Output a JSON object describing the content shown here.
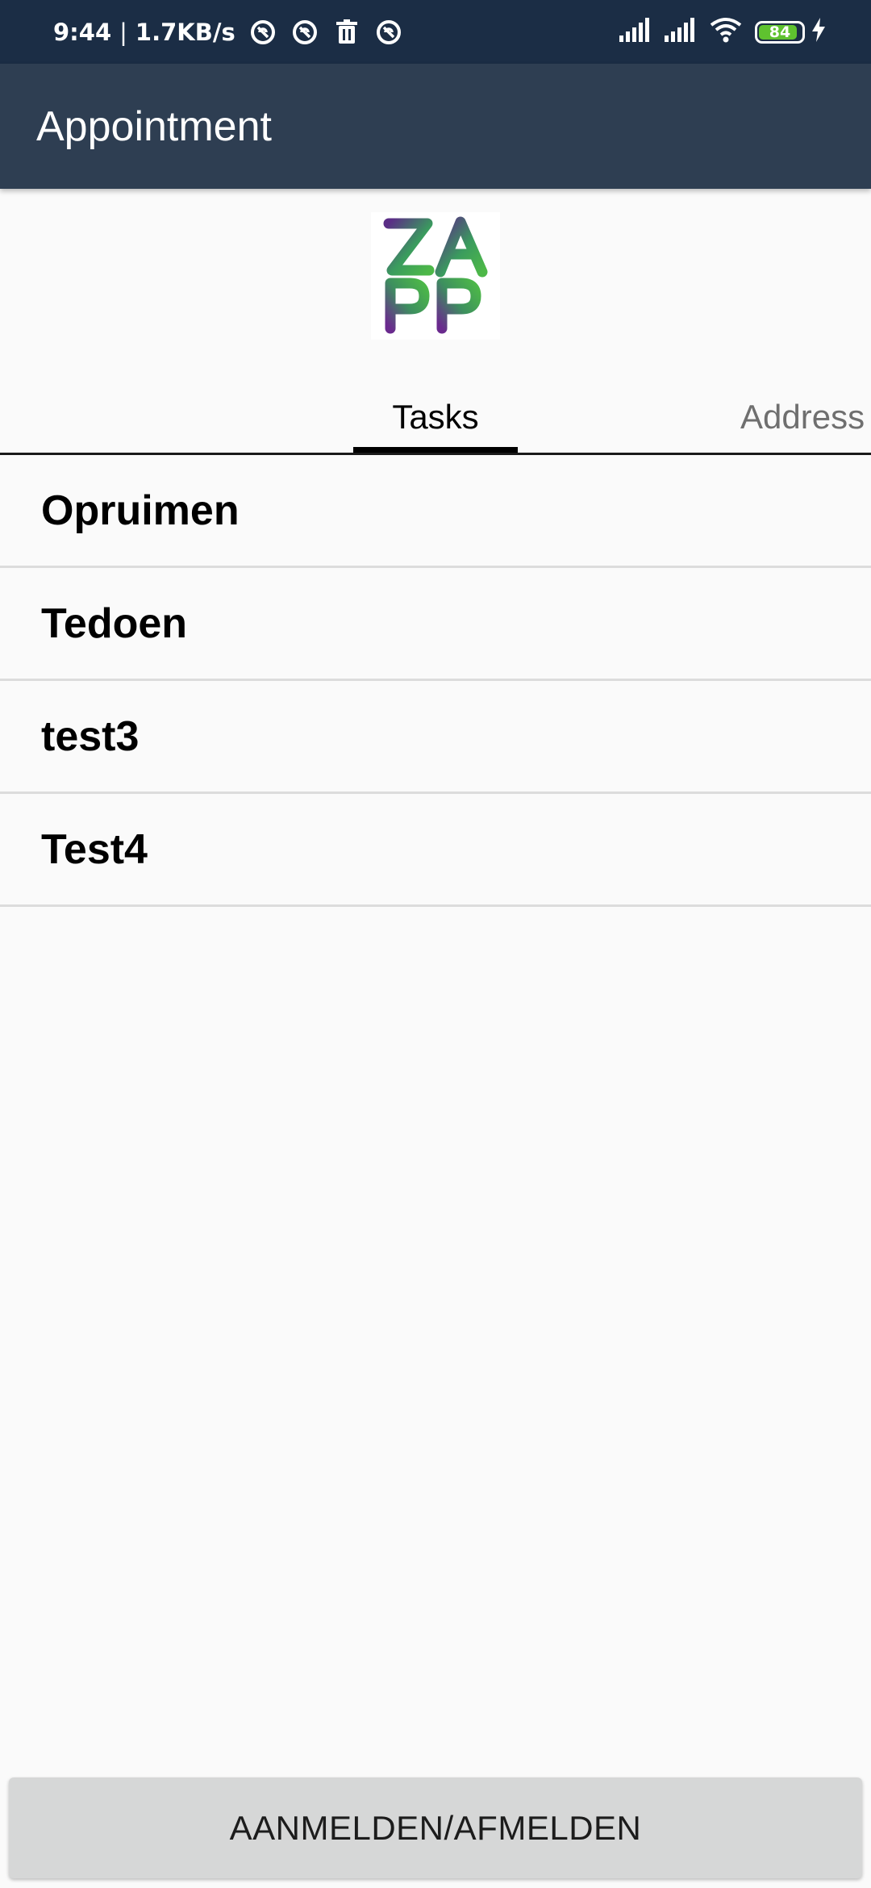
{
  "status_bar": {
    "time": "9:44",
    "separator": "|",
    "network_speed": "1.7KB/s",
    "battery_level": "84",
    "icons": [
      "notification-icon",
      "notification-icon",
      "trash-icon",
      "notification-icon",
      "signal-icon",
      "signal-icon",
      "wifi-icon",
      "battery-icon",
      "charging-icon"
    ],
    "battery_color": "#5fc22f"
  },
  "app_bar": {
    "title": "Appointment",
    "background": "#2e3e52"
  },
  "logo": {
    "row1": "ZA",
    "row2": "PP"
  },
  "tabs": [
    {
      "label": "Tasks",
      "selected": true
    },
    {
      "label": "Address",
      "selected": false
    }
  ],
  "tasks": [
    {
      "label": "Opruimen"
    },
    {
      "label": "Tedoen"
    },
    {
      "label": "test3"
    },
    {
      "label": "Test4"
    }
  ],
  "bottom_button": {
    "label": "AANMELDEN/AFMELDEN"
  }
}
